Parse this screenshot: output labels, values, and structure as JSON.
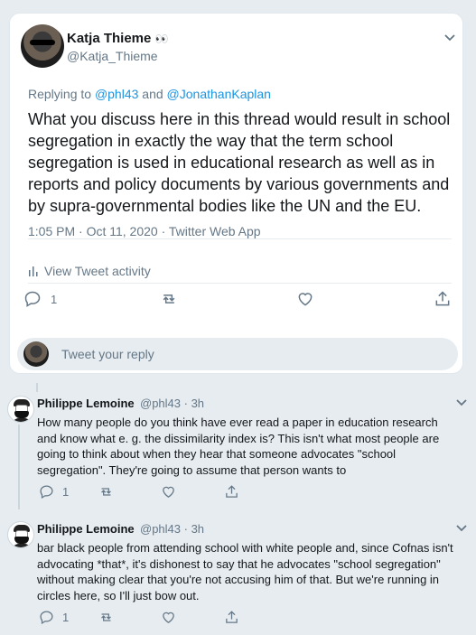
{
  "main_tweet": {
    "display_name": "Katja Thieme",
    "name_emoji": "👀",
    "handle": "@Katja_Thieme",
    "replying_prefix": "Replying to ",
    "replying_to_1": "@phl43",
    "replying_and": " and ",
    "replying_to_2": "@JonathanKaplan",
    "text": "What you discuss here in this thread would result in school segregation in exactly the way that the term school segregation is used in educational research as well as in reports and policy documents by various governments and by supra-governmental bodies like the UN and the EU.",
    "time": "1:05 PM · Oct 11, 2020 · Twitter Web App",
    "activity_label": "View Tweet activity",
    "reply_count": "1",
    "reply_placeholder": "Tweet your reply"
  },
  "replies": [
    {
      "display_name": "Philippe Lemoine",
      "handle": "@phl43",
      "time": "· 3h",
      "text": "How many people do you think have ever read a paper in education research and know what e. g. the dissimilarity index is? This isn't what most people are going to think about when they hear that someone advocates \"school segregation\". They're going to assume that person wants to",
      "reply_count": "1"
    },
    {
      "display_name": "Philippe Lemoine",
      "handle": "@phl43",
      "time": "· 3h",
      "text": "bar black people from attending school with white people and, since Cofnas isn't advocating *that*, it's dishonest to say that he advocates \"school segregation\" without making clear that you're not accusing him of that. But we're running in circles here, so I'll just bow out.",
      "reply_count": "1"
    }
  ],
  "colors": {
    "link": "#1b95e0",
    "muted": "#657786",
    "background": "#e6ecf0"
  }
}
